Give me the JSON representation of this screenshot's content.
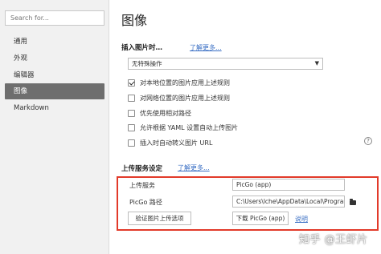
{
  "sidebar": {
    "search_placeholder": "Search for...",
    "items": [
      {
        "label": "通用"
      },
      {
        "label": "外观"
      },
      {
        "label": "编辑器"
      },
      {
        "label": "图像"
      },
      {
        "label": "Markdown"
      }
    ]
  },
  "main": {
    "title": "图像",
    "insert": {
      "heading": "插入图片时…",
      "learn_more": "了解更多...",
      "action_value": "无特殊操作",
      "options": [
        {
          "label": "对本地位置的图片应用上述规则",
          "checked": true
        },
        {
          "label": "对网络位置的图片应用上述规则",
          "checked": false
        },
        {
          "label": "优先使用相对路径",
          "checked": false
        },
        {
          "label": "允许根据 YAML 设置自动上传图片",
          "checked": false
        },
        {
          "label": "插入时自动转义图片 URL",
          "checked": false
        }
      ],
      "help_icon": "?"
    },
    "upload": {
      "heading": "上传服务设定",
      "learn_more": "了解更多...",
      "service_label": "上传服务",
      "service_value": "PicGo (app)",
      "path_label": "PicGo 路径",
      "path_value": "C:\\Users\\lche\\AppData\\Local\\Programs\\",
      "verify_button": "验证图片上传选项",
      "download_button": "下载 PicGo (app)",
      "help_link": "说明",
      "highlight_color": "#e23a2a"
    }
  },
  "watermark": "知乎 @王虾片"
}
